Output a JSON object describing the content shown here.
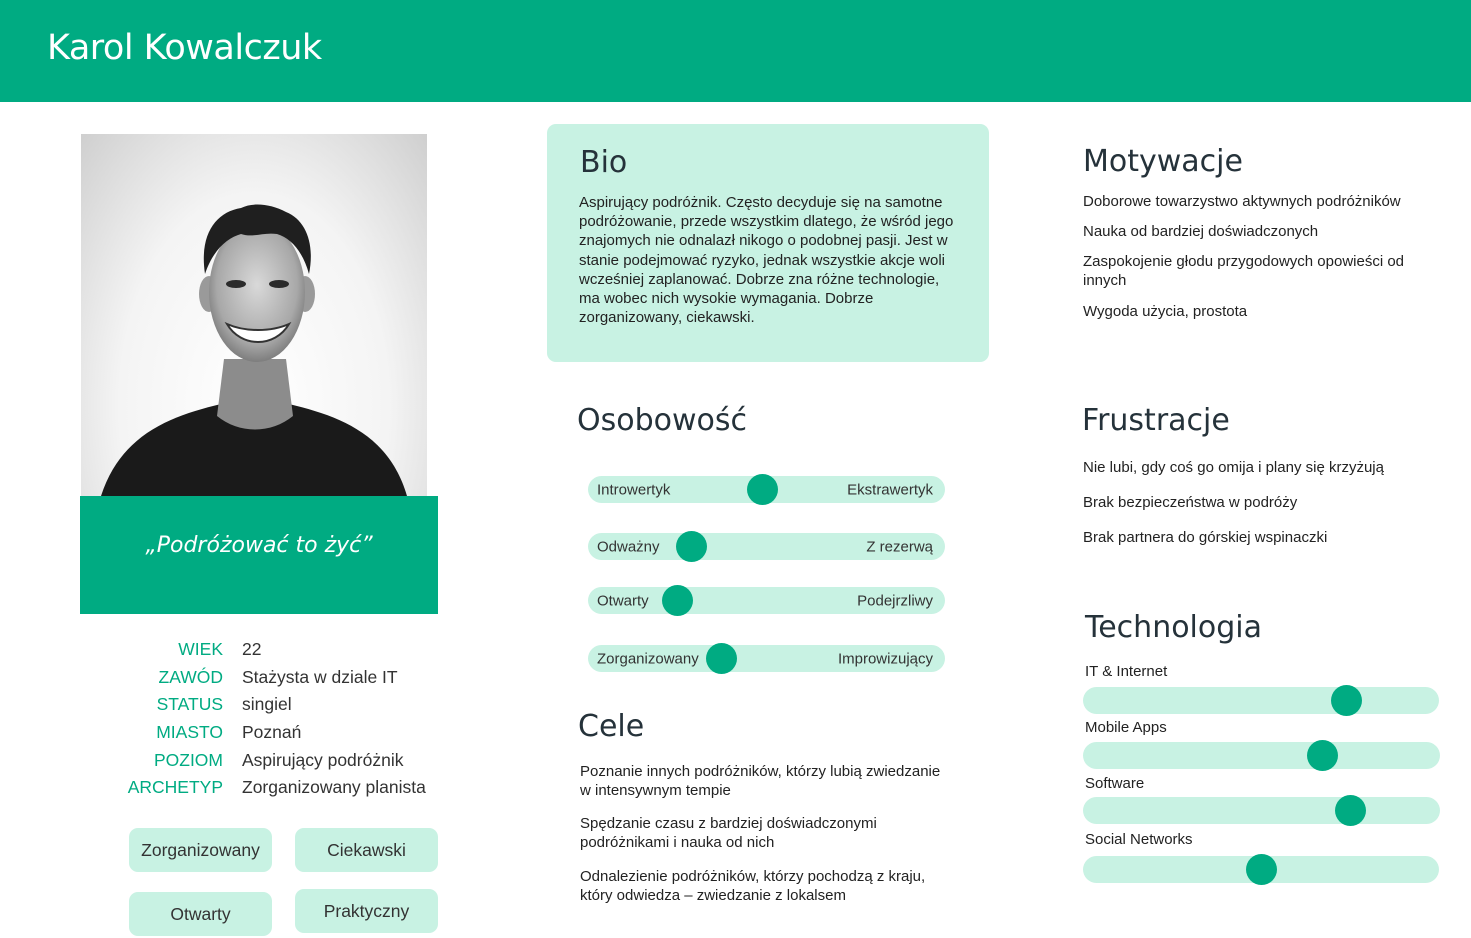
{
  "header": {
    "name": "Karol Kowalczuk"
  },
  "profile": {
    "quote": "„Podróżować to żyć”",
    "facts": [
      {
        "label": "WIEK",
        "value": "22"
      },
      {
        "label": "ZAWÓD",
        "value": "Stażysta w dziale IT"
      },
      {
        "label": "STATUS",
        "value": "singiel"
      },
      {
        "label": "MIASTO",
        "value": "Poznań"
      },
      {
        "label": "POZIOM",
        "value": "Aspirujący podróżnik"
      },
      {
        "label": "ARCHETYP",
        "value": "Zorganizowany planista"
      }
    ],
    "traits": [
      "Zorganizowany",
      "Ciekawski",
      "Otwarty",
      "Praktyczny"
    ]
  },
  "bio": {
    "title": "Bio",
    "text": "Aspirujący podróżnik. Często decyduje się na samotne podróżowanie, przede wszystkim dlatego, że wśród jego znajomych nie odnalazł nikogo o podobnej pasji. Jest w stanie podejmować ryzyko, jednak wszystkie akcje woli wcześniej zaplanować. Dobrze zna różne technologie, ma wobec nich wysokie wymagania. Dobrze zorganizowany, ciekawski."
  },
  "personality": {
    "title": "Osobowość",
    "scales": [
      {
        "left": "Introwertyk",
        "right": "Ekstrawertyk",
        "level": 0.49
      },
      {
        "left": "Odważny",
        "right": "Z rezerwą",
        "level": 0.29
      },
      {
        "left": "Otwarty",
        "right": "Podejrzliwy",
        "level": 0.25
      },
      {
        "left": "Zorganizowany",
        "right": "Improwizujący",
        "level": 0.375
      }
    ]
  },
  "goals": {
    "title": "Cele",
    "items": [
      "Poznanie innych podróżników, którzy lubią zwiedzanie w intensywnym tempie",
      "Spędzanie czasu z bardziej doświadczonymi podróżnikami i nauka od nich",
      "Odnalezienie podróżników, którzy pochodzą z kraju, który odwiedza – zwiedzanie z lokalsem"
    ]
  },
  "motivations": {
    "title": "Motywacje",
    "items": [
      "Doborowe towarzystwo aktywnych podróżników",
      "Nauka od bardziej doświadczonych",
      "Zaspokojenie głodu przygodowych opowieści od innych",
      "Wygoda użycia, prostota"
    ]
  },
  "frustrations": {
    "title": "Frustracje",
    "items": [
      "Nie lubi, gdy coś go omija i plany się krzyżują",
      "Brak bezpieczeństwa w podróży",
      "Brak partnera do górskiej wspinaczki"
    ]
  },
  "technology": {
    "title": "Technologia",
    "items": [
      {
        "label": "IT & Internet",
        "level": 0.74
      },
      {
        "label": "Mobile Apps",
        "level": 0.67
      },
      {
        "label": "Software",
        "level": 0.75
      },
      {
        "label": "Social Networks",
        "level": 0.5
      }
    ]
  },
  "colors": {
    "accent": "#00ab82",
    "light": "#c8f2e3",
    "text": "#25323a"
  }
}
